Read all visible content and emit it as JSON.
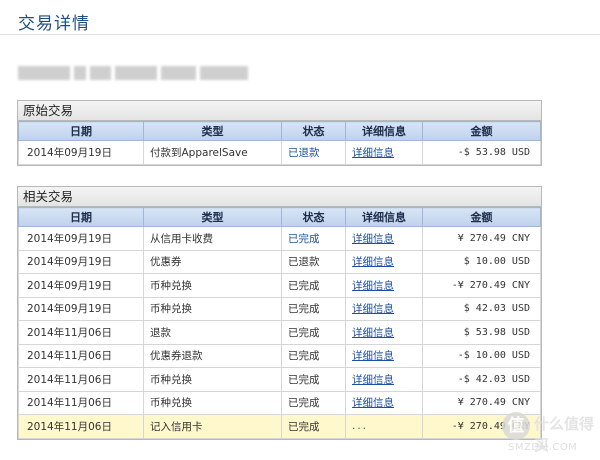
{
  "header": {
    "title": "交易详情"
  },
  "columns": {
    "date": "日期",
    "type": "类型",
    "status": "状态",
    "detail": "详细信息",
    "amount": "金额"
  },
  "original": {
    "section_title": "原始交易",
    "rows": [
      {
        "date": "2014年09月19日",
        "type": "付款到ApparelSave",
        "status": "已退款",
        "detail": "详细信息",
        "amount": "-$ 53.98 USD"
      }
    ]
  },
  "related": {
    "section_title": "相关交易",
    "rows": [
      {
        "date": "2014年09月19日",
        "type": "从信用卡收费",
        "status": "已完成",
        "detail": "详细信息",
        "amount": "¥ 270.49 CNY"
      },
      {
        "date": "2014年09月19日",
        "type": "优惠券",
        "status": "已退款",
        "detail": "详细信息",
        "amount": "$ 10.00 USD"
      },
      {
        "date": "2014年09月19日",
        "type": "币种兑换",
        "status": "已完成",
        "detail": "详细信息",
        "amount": "-¥ 270.49 CNY"
      },
      {
        "date": "2014年09月19日",
        "type": "币种兑换",
        "status": "已完成",
        "detail": "详细信息",
        "amount": "$ 42.03 USD"
      },
      {
        "date": "2014年11月06日",
        "type": "退款",
        "status": "已完成",
        "detail": "详细信息",
        "amount": "$ 53.98 USD"
      },
      {
        "date": "2014年11月06日",
        "type": "优惠券退款",
        "status": "已完成",
        "detail": "详细信息",
        "amount": "-$ 10.00 USD"
      },
      {
        "date": "2014年11月06日",
        "type": "币种兑换",
        "status": "已完成",
        "detail": "详细信息",
        "amount": "-$ 42.03 USD"
      },
      {
        "date": "2014年11月06日",
        "type": "币种兑换",
        "status": "已完成",
        "detail": "详细信息",
        "amount": "¥ 270.49 CNY"
      },
      {
        "date": "2014年11月06日",
        "type": "记入信用卡",
        "status": "已完成",
        "detail": "...",
        "amount": "-¥ 270.49 CNY"
      }
    ]
  },
  "watermark": {
    "glyph": "值",
    "text": "什么值得买",
    "sub": "SMZDM.COM"
  }
}
